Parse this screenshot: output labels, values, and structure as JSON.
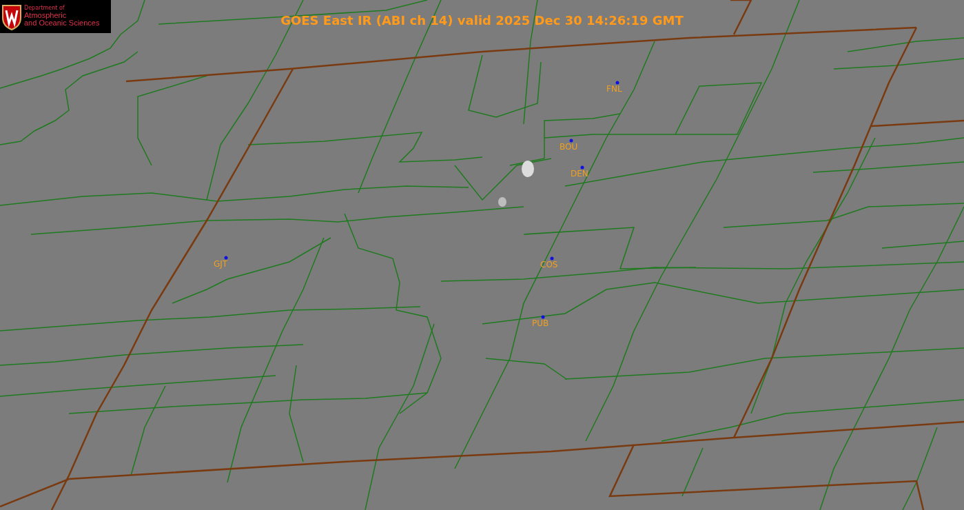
{
  "logo": {
    "department": "Department of",
    "name_line_1": "Atmospheric",
    "name_line_2": "and Oceanic Sciences"
  },
  "title": "GOES East IR (ABI ch 14) valid 2025 Dec 30 14:26:19 GMT",
  "stations": [
    {
      "name": "FNL"
    },
    {
      "name": "BOU"
    },
    {
      "name": "DEN"
    },
    {
      "name": "GJT"
    },
    {
      "name": "COS"
    },
    {
      "name": "PUB"
    }
  ]
}
